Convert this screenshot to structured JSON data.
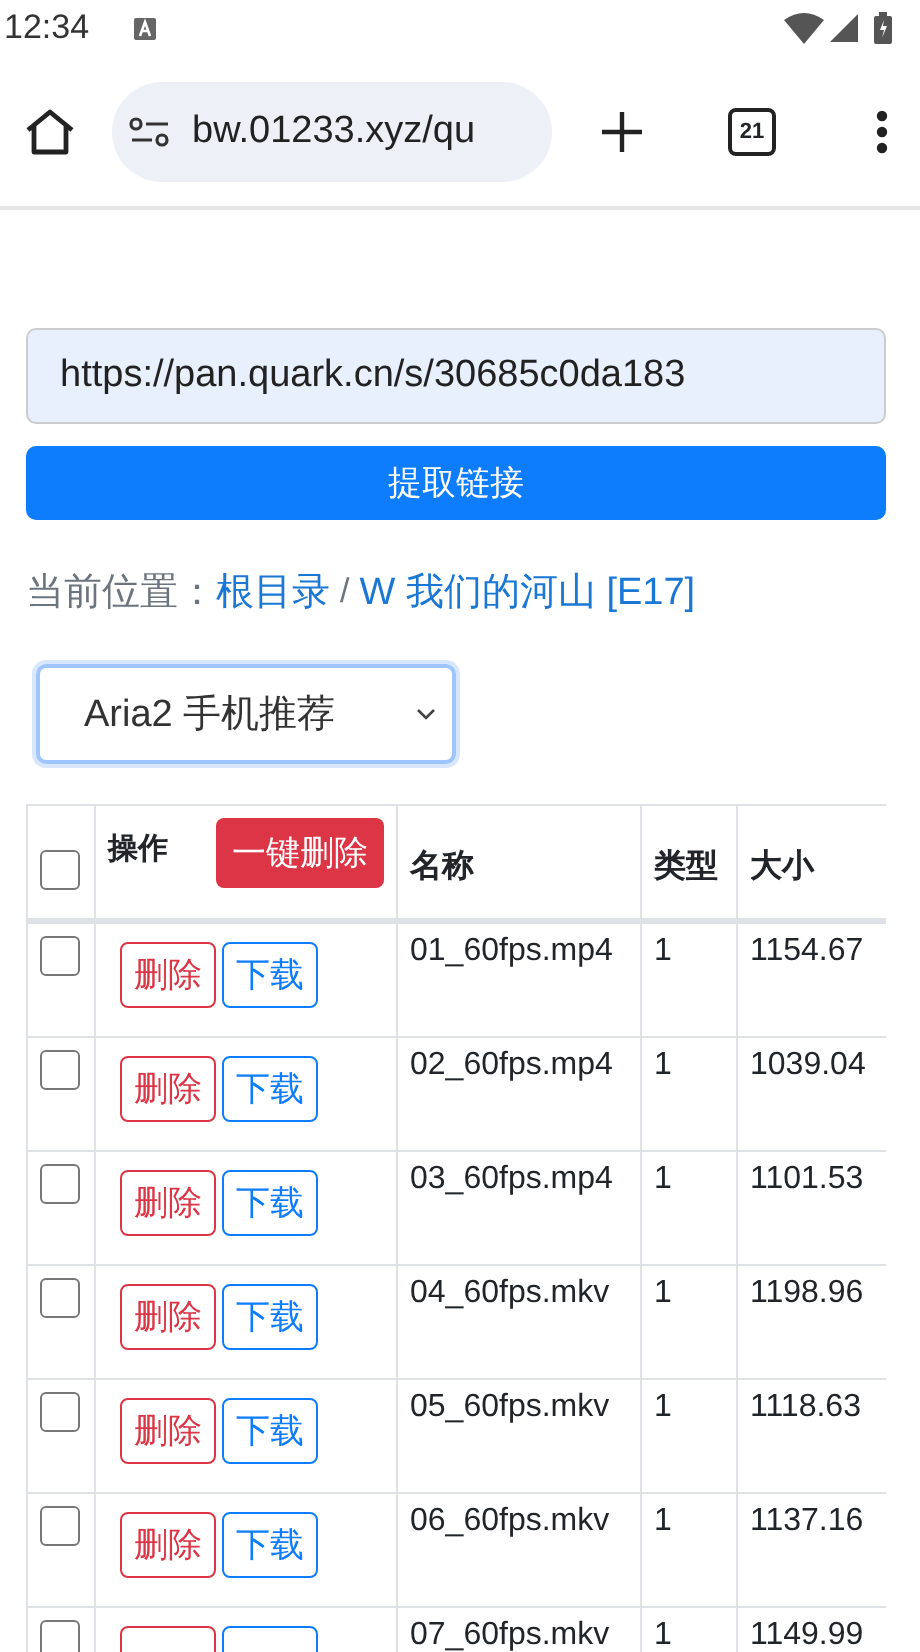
{
  "status_bar": {
    "time": "12:34"
  },
  "browser": {
    "url": "bw.01233.xyz/qu",
    "tab_count": "21"
  },
  "form": {
    "link_value": "https://pan.quark.cn/s/30685c0da183",
    "extract_button": "提取链接"
  },
  "breadcrumb": {
    "label": "当前位置：",
    "items": [
      "根目录",
      "W 我们的河山 [E17]"
    ],
    "separator": "/"
  },
  "downloader": {
    "value": "Aria2 手机推荐"
  },
  "table": {
    "header_checked": false,
    "bulk_delete": "一键删除",
    "columns": [
      "操作",
      "名称",
      "类型",
      "大小"
    ],
    "rows": [
      {
        "checked": false,
        "name": "01_60fps.mp4",
        "type": "1",
        "size": "1154.67",
        "delete": "删除",
        "download": "下载"
      },
      {
        "checked": false,
        "name": "02_60fps.mp4",
        "type": "1",
        "size": "1039.04",
        "delete": "删除",
        "download": "下载"
      },
      {
        "checked": false,
        "name": "03_60fps.mp4",
        "type": "1",
        "size": "1101.53",
        "delete": "删除",
        "download": "下载"
      },
      {
        "checked": false,
        "name": "04_60fps.mkv",
        "type": "1",
        "size": "1198.96",
        "delete": "删除",
        "download": "下载"
      },
      {
        "checked": false,
        "name": "05_60fps.mkv",
        "type": "1",
        "size": "1118.63",
        "delete": "删除",
        "download": "下载"
      },
      {
        "checked": false,
        "name": "06_60fps.mkv",
        "type": "1",
        "size": "1137.16",
        "delete": "删除",
        "download": "下载"
      },
      {
        "checked": false,
        "name": "07_60fps.mkv",
        "type": "1",
        "size": "1149.99"
      }
    ]
  }
}
